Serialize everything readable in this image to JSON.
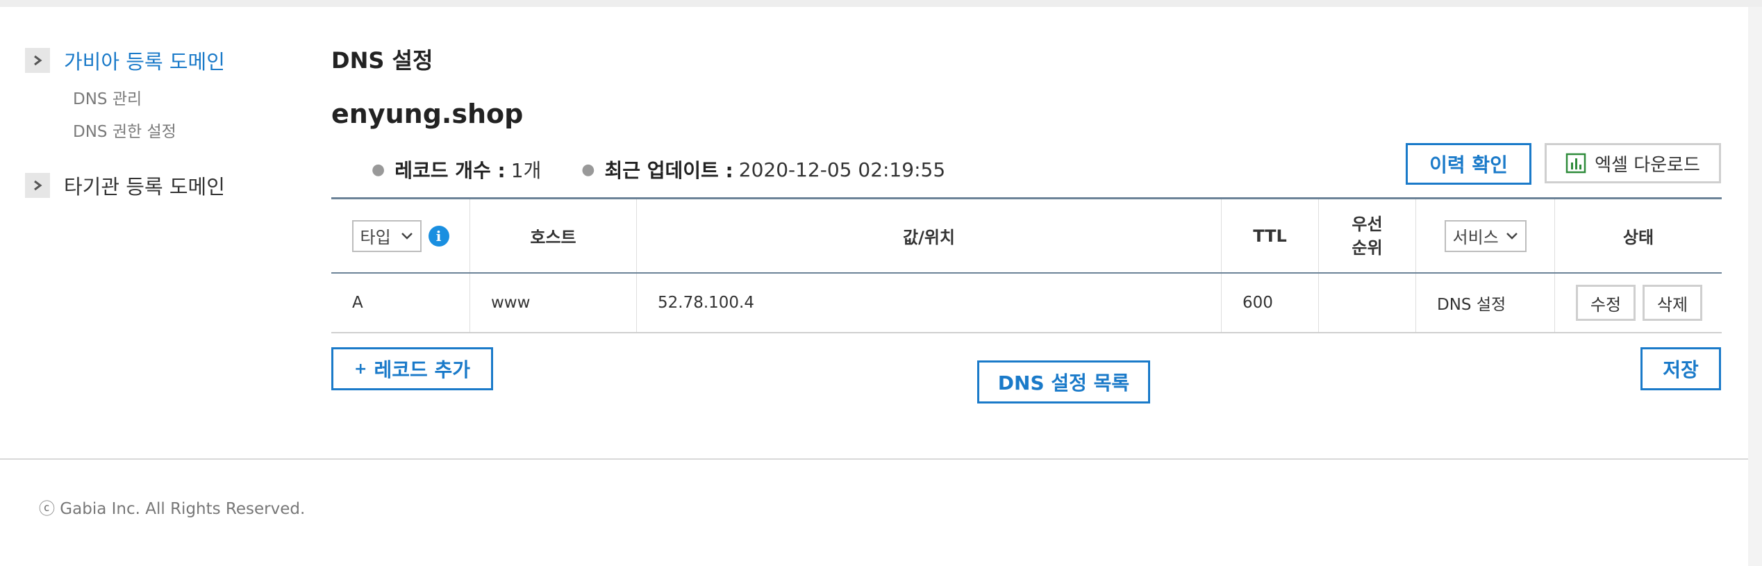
{
  "sidebar": {
    "groups": [
      {
        "title": "가비아 등록 도메인",
        "items": [
          "DNS 관리",
          "DNS 권한 설정"
        ]
      },
      {
        "title": "타기관 등록 도메인",
        "items": []
      }
    ]
  },
  "page": {
    "title": "DNS 설정",
    "domain": "enyung.shop",
    "record_count_label": "레코드 개수 :",
    "record_count_value": "1개",
    "updated_label": "최근 업데이트 :",
    "updated_value": "2020-12-05 02:19:55"
  },
  "buttons": {
    "history": "이력 확인",
    "excel": "엑셀 다운로드",
    "add": "레코드 추가",
    "add_plus": "+",
    "list": "DNS 설정 목록",
    "save": "저장",
    "edit": "수정",
    "delete": "삭제"
  },
  "table": {
    "headers": {
      "type": "타입",
      "host": "호스트",
      "value": "값/위치",
      "ttl": "TTL",
      "priority_line1": "우선",
      "priority_line2": "순위",
      "service": "서비스",
      "status": "상태"
    },
    "rows": [
      {
        "type": "A",
        "host": "www",
        "value": "52.78.100.4",
        "ttl": "600",
        "priority": "",
        "service": "DNS 설정"
      }
    ]
  },
  "footer": {
    "copyright": "ⓒ Gabia Inc. All Rights Reserved."
  },
  "colors": {
    "accent": "#1a7ac9",
    "info": "#1a8fe0",
    "excel": "#2e8b3a"
  },
  "icons": {
    "chevron": "chevron-right-icon",
    "info": "info-icon",
    "excel": "excel-chart-icon",
    "dropdown": "chevron-down-icon"
  }
}
